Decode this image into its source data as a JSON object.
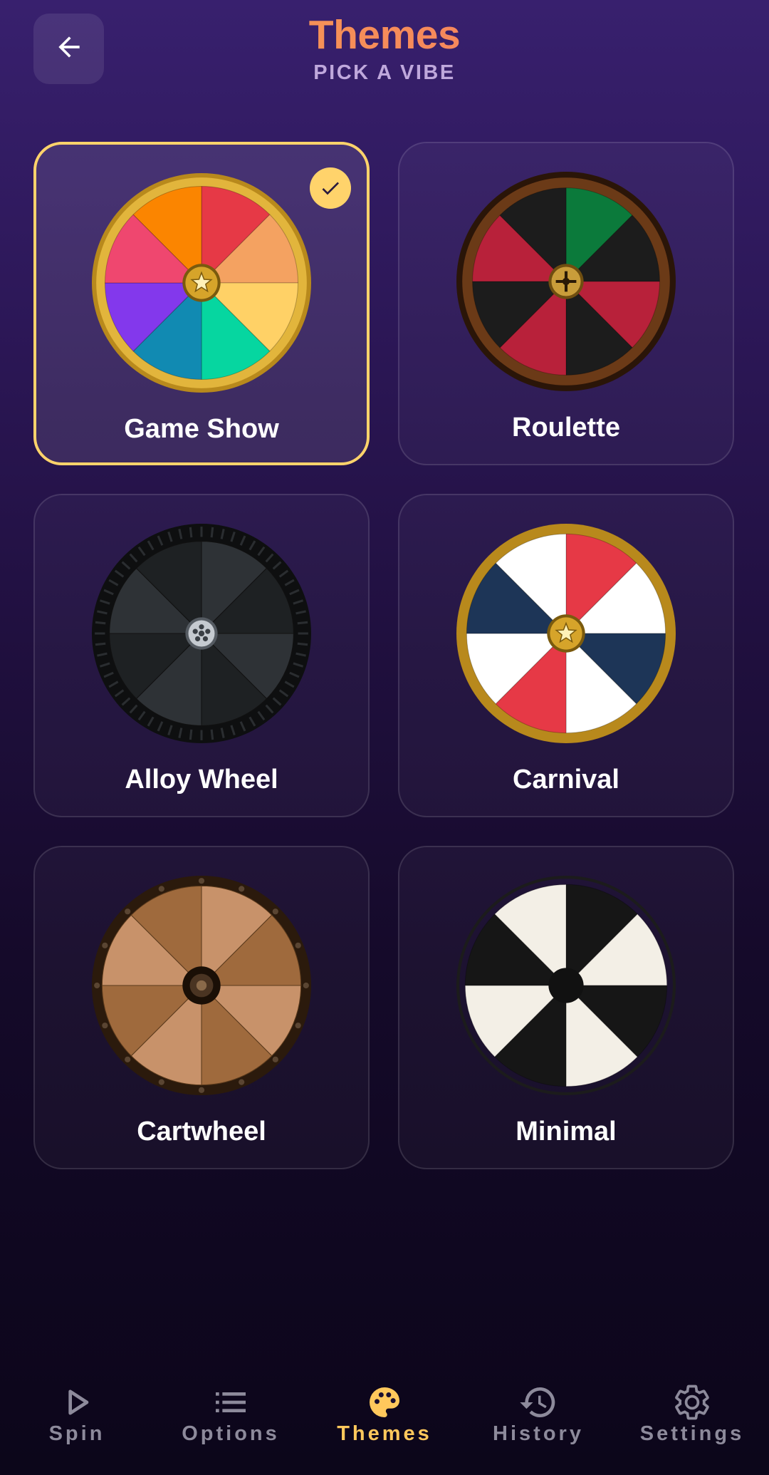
{
  "header": {
    "title": "Themes",
    "subtitle": "PICK A VIBE"
  },
  "themes": [
    {
      "label": "Game Show",
      "selected": true,
      "style": "game-show",
      "segments": [
        "#e63946",
        "#f4a261",
        "#ffd166",
        "#06d6a0",
        "#118ab2",
        "#8338ec",
        "#ef476f",
        "#fb8500"
      ]
    },
    {
      "label": "Roulette",
      "selected": false,
      "style": "roulette",
      "segments": [
        "#0b7a3b",
        "#1c1c1c",
        "#b8213a",
        "#1c1c1c",
        "#b8213a",
        "#1c1c1c",
        "#b8213a",
        "#1c1c1c"
      ]
    },
    {
      "label": "Alloy Wheel",
      "selected": false,
      "style": "alloy",
      "segments": [
        "#2e3236",
        "#1e2123",
        "#2e3236",
        "#1e2123",
        "#2e3236",
        "#1e2123",
        "#2e3236",
        "#1e2123"
      ]
    },
    {
      "label": "Carnival",
      "selected": false,
      "style": "carnival",
      "segments": [
        "#e63946",
        "#ffffff",
        "#1d3557",
        "#ffffff",
        "#e63946",
        "#ffffff",
        "#1d3557",
        "#ffffff"
      ]
    },
    {
      "label": "Cartwheel",
      "selected": false,
      "style": "cartwheel",
      "segments": [
        "#c8926a",
        "#9f6a3d",
        "#c8926a",
        "#9f6a3d",
        "#c8926a",
        "#9f6a3d",
        "#c8926a",
        "#9f6a3d"
      ]
    },
    {
      "label": "Minimal",
      "selected": false,
      "style": "minimal",
      "segments": [
        "#161616",
        "#f3efe6",
        "#161616",
        "#f3efe6",
        "#161616",
        "#f3efe6",
        "#161616",
        "#f3efe6"
      ]
    }
  ],
  "nav": [
    {
      "label": "Spin",
      "icon": "play-icon",
      "active": false
    },
    {
      "label": "Options",
      "icon": "list-icon",
      "active": false
    },
    {
      "label": "Themes",
      "icon": "palette-icon",
      "active": true
    },
    {
      "label": "History",
      "icon": "history-icon",
      "active": false
    },
    {
      "label": "Settings",
      "icon": "gear-icon",
      "active": false
    }
  ],
  "colors": {
    "accent": "#ffd36b",
    "title_gradient_start": "#f6a24c",
    "title_gradient_end": "#f57767",
    "subtitle": "#bfa8dc",
    "nav_inactive": "#8d8a9b",
    "nav_active": "#ffc85c"
  }
}
